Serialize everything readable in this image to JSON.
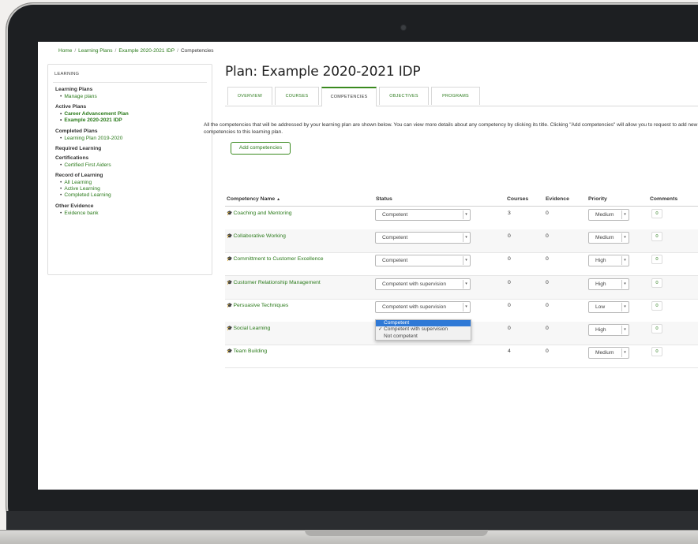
{
  "breadcrumb": [
    "Home",
    "Learning Plans",
    "Example 2020-2021 IDP",
    "Competencies"
  ],
  "sidebar": {
    "header": "LEARNING",
    "sections": [
      {
        "title": "Learning Plans",
        "items": [
          {
            "label": "Manage plans",
            "bold": false
          }
        ]
      },
      {
        "title": "Active Plans",
        "items": [
          {
            "label": "Career Advancement Plan",
            "bold": true
          },
          {
            "label": "Example 2020-2021 IDP",
            "bold": true
          }
        ]
      },
      {
        "title": "Completed Plans",
        "items": [
          {
            "label": "Learning Plan 2019-2020",
            "bold": false
          }
        ]
      },
      {
        "title": "Required Learning",
        "items": []
      },
      {
        "title": "Certifications",
        "items": [
          {
            "label": "Certified First Aiders",
            "bold": false
          }
        ]
      },
      {
        "title": "Record of Learning",
        "items": [
          {
            "label": "All Learning",
            "bold": false
          },
          {
            "label": "Active Learning",
            "bold": false
          },
          {
            "label": "Completed Learning",
            "bold": false
          }
        ]
      },
      {
        "title": "Other Evidence",
        "items": [
          {
            "label": "Evidence bank",
            "bold": false
          }
        ]
      }
    ]
  },
  "page_title": "Plan: Example 2020-2021 IDP",
  "tabs": [
    {
      "label": "OVERVIEW",
      "active": false
    },
    {
      "label": "COURSES",
      "active": false
    },
    {
      "label": "COMPETENCIES",
      "active": true
    },
    {
      "label": "OBJECTIVES",
      "active": false
    },
    {
      "label": "PROGRAMS",
      "active": false
    }
  ],
  "intro_text": "All the competencies that will be addressed by your learning plan are shown below. You can view more details about any competency by clicking its title. Clicking \"Add competencies\" will allow you to request to add new competencies to this learning plan.",
  "add_button": "Add competencies",
  "table": {
    "headers": {
      "name": "Competency Name",
      "sort_icon": "▲",
      "status": "Status",
      "courses": "Courses",
      "evidence": "Evidence",
      "priority": "Priority",
      "comments": "Comments"
    },
    "rows": [
      {
        "name": "Coaching and Mentoring",
        "status": "Competent",
        "courses": "3",
        "evidence": "0",
        "priority": "Medium",
        "comments": "0"
      },
      {
        "name": "Collaborative Working",
        "status": "Competent",
        "courses": "0",
        "evidence": "0",
        "priority": "Medium",
        "comments": "0"
      },
      {
        "name": "Committment to Customer Excellence",
        "status": "Competent",
        "courses": "0",
        "evidence": "0",
        "priority": "High",
        "comments": "0"
      },
      {
        "name": "Customer Relationship Management",
        "status": "Competent with supervision",
        "courses": "0",
        "evidence": "0",
        "priority": "High",
        "comments": "0"
      },
      {
        "name": "Persuasive Techniques",
        "status": "Competent with supervision",
        "courses": "0",
        "evidence": "0",
        "priority": "Low",
        "comments": "0"
      },
      {
        "name": "Social Learning",
        "status": "Competent",
        "courses": "0",
        "evidence": "0",
        "priority": "High",
        "comments": "0"
      },
      {
        "name": "Team Building",
        "status": "",
        "courses": "4",
        "evidence": "0",
        "priority": "Medium",
        "comments": "0"
      }
    ]
  },
  "status_dropdown": {
    "options": [
      "Competent",
      "Competent with supervision",
      "Not competent"
    ],
    "highlighted": "Competent",
    "checked": "Competent with supervision"
  },
  "colors": {
    "link": "#2a7a1a",
    "accent": "#3a8a1f",
    "highlight": "#2f79d6"
  },
  "icons": {
    "competency": "graduation-cap-icon",
    "select_arrow": "chevron-down-icon"
  }
}
